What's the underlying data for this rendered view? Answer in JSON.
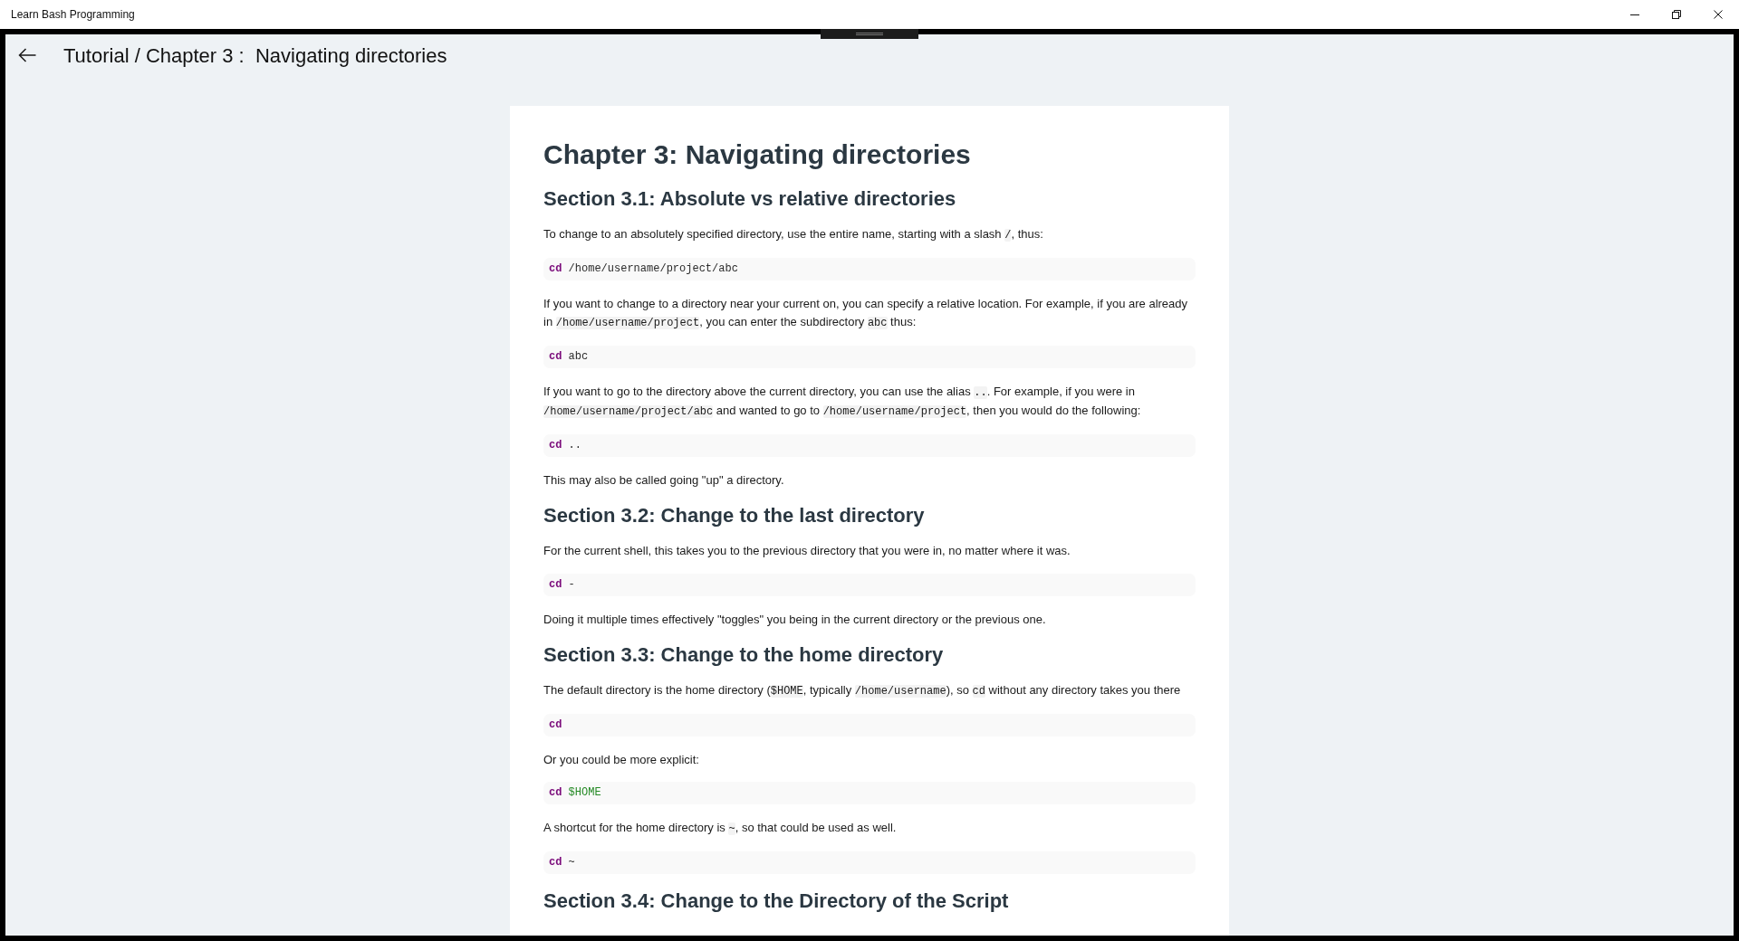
{
  "window": {
    "title": "Learn Bash Programming"
  },
  "header": {
    "title": "Tutorial / Chapter 3 :  Navigating directories"
  },
  "article": {
    "title": "Chapter 3: Navigating directories",
    "blocks": [
      {
        "kind": "heading",
        "text": "Section 3.1: Absolute vs relative directories"
      },
      {
        "kind": "paragraph",
        "parts": [
          {
            "kind": "text",
            "text": "To change to an absolutely specified directory, use the entire name, starting with a slash "
          },
          {
            "kind": "code",
            "text": "/"
          },
          {
            "kind": "text",
            "text": ", thus:"
          }
        ]
      },
      {
        "kind": "code",
        "tokens": [
          {
            "kind": "keyword",
            "text": "cd"
          },
          {
            "kind": "plain",
            "text": "/home/username/project/abc"
          }
        ]
      },
      {
        "kind": "paragraph",
        "parts": [
          {
            "kind": "text",
            "text": "If you want to change to a directory near your current on, you can specify a relative location. For example, if you are already in "
          },
          {
            "kind": "code",
            "text": "/home/username/project"
          },
          {
            "kind": "text",
            "text": ", you can enter the subdirectory "
          },
          {
            "kind": "code",
            "text": "abc"
          },
          {
            "kind": "text",
            "text": " thus:"
          }
        ]
      },
      {
        "kind": "code",
        "tokens": [
          {
            "kind": "keyword",
            "text": "cd"
          },
          {
            "kind": "plain",
            "text": "abc"
          }
        ]
      },
      {
        "kind": "paragraph",
        "parts": [
          {
            "kind": "text",
            "text": "If you want to go to the directory above the current directory, you can use the alias "
          },
          {
            "kind": "code",
            "text": ".."
          },
          {
            "kind": "text",
            "text": ". For example, if you were in "
          },
          {
            "kind": "code",
            "text": "/home/username/project/abc"
          },
          {
            "kind": "text",
            "text": " and wanted to go to "
          },
          {
            "kind": "code",
            "text": "/home/username/project"
          },
          {
            "kind": "text",
            "text": ", then you would do the following:"
          }
        ]
      },
      {
        "kind": "code",
        "tokens": [
          {
            "kind": "keyword",
            "text": "cd"
          },
          {
            "kind": "plain",
            "text": ".."
          }
        ]
      },
      {
        "kind": "paragraph",
        "parts": [
          {
            "kind": "text",
            "text": "This may also be called going \"up\" a directory."
          }
        ]
      },
      {
        "kind": "heading",
        "text": "Section 3.2: Change to the last directory"
      },
      {
        "kind": "paragraph",
        "parts": [
          {
            "kind": "text",
            "text": "For the current shell, this takes you to the previous directory that you were in, no matter where it was."
          }
        ]
      },
      {
        "kind": "code",
        "tokens": [
          {
            "kind": "keyword",
            "text": "cd"
          },
          {
            "kind": "plain",
            "text": "-"
          }
        ]
      },
      {
        "kind": "paragraph",
        "parts": [
          {
            "kind": "text",
            "text": "Doing it multiple times effectively \"toggles\" you being in the current directory or the previous one."
          }
        ]
      },
      {
        "kind": "heading",
        "text": "Section 3.3: Change to the home directory"
      },
      {
        "kind": "paragraph",
        "parts": [
          {
            "kind": "text",
            "text": "The default directory is the home directory ("
          },
          {
            "kind": "code",
            "text": "$HOME"
          },
          {
            "kind": "text",
            "text": ", typically "
          },
          {
            "kind": "code",
            "text": "/home/username"
          },
          {
            "kind": "text",
            "text": "), so "
          },
          {
            "kind": "code",
            "text": "cd"
          },
          {
            "kind": "text",
            "text": " without any directory takes you there"
          }
        ]
      },
      {
        "kind": "code",
        "tokens": [
          {
            "kind": "keyword",
            "text": "cd"
          }
        ]
      },
      {
        "kind": "paragraph",
        "parts": [
          {
            "kind": "text",
            "text": "Or you could be more explicit:"
          }
        ]
      },
      {
        "kind": "code",
        "tokens": [
          {
            "kind": "keyword",
            "text": "cd"
          },
          {
            "kind": "variable",
            "text": "$HOME"
          }
        ]
      },
      {
        "kind": "paragraph",
        "parts": [
          {
            "kind": "text",
            "text": "A shortcut for the home directory is "
          },
          {
            "kind": "code",
            "text": "~"
          },
          {
            "kind": "text",
            "text": ", so that could be used as well."
          }
        ]
      },
      {
        "kind": "code",
        "tokens": [
          {
            "kind": "keyword",
            "text": "cd"
          },
          {
            "kind": "plain",
            "text": "~"
          }
        ]
      },
      {
        "kind": "heading",
        "text": "Section 3.4: Change to the Directory of the Script"
      }
    ]
  }
}
